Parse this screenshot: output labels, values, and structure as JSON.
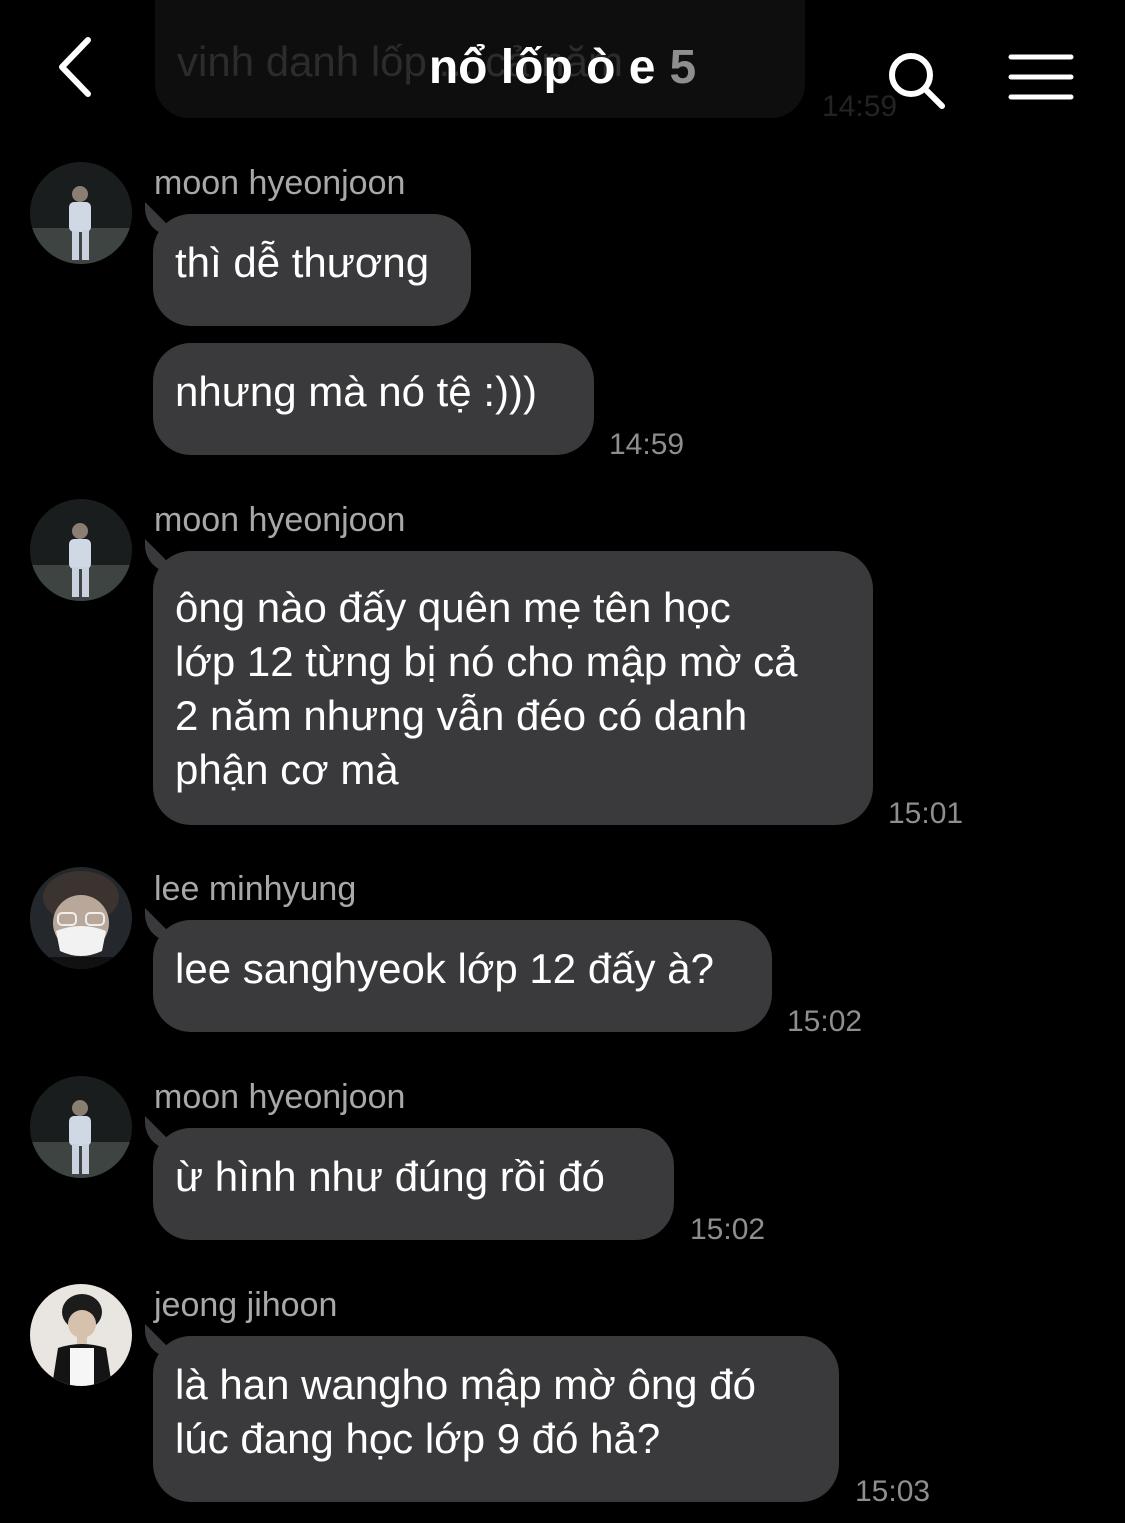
{
  "header": {
    "title": "nổ lốp ò e",
    "member_count": "5",
    "back_icon": "chevron-left-icon",
    "search_icon": "search-icon",
    "menu_icon": "hamburger-menu-icon"
  },
  "previous_message": {
    "text": "vinh danh lốp ... cả năm",
    "time": "14:59"
  },
  "messages": [
    {
      "sender": "moon hyeonjoon",
      "bubbles": [
        "thì dễ thương",
        "nhưng mà nó tệ :)))"
      ],
      "time": "14:59"
    },
    {
      "sender": "moon hyeonjoon",
      "bubbles": [
        "ông nào đấy quên mẹ tên học\nlớp 12 từng bị nó cho mập mờ cả\n2 năm nhưng vẫn đéo có danh\nphận cơ mà"
      ],
      "time": "15:01"
    },
    {
      "sender": "lee minhyung",
      "bubbles": [
        "lee sanghyeok lớp 12 đấy à?"
      ],
      "time": "15:02"
    },
    {
      "sender": "moon hyeonjoon",
      "bubbles": [
        "ừ hình như đúng rồi đó"
      ],
      "time": "15:02"
    },
    {
      "sender": "jeong jihoon",
      "bubbles": [
        "là han wangho mập mờ ông đó\nlúc đang học lớp 9 đó hả?"
      ],
      "time": "15:03"
    }
  ],
  "colors": {
    "background": "#000000",
    "bubble": "#3a3a3c",
    "secondary_text": "#8e8e8e"
  }
}
